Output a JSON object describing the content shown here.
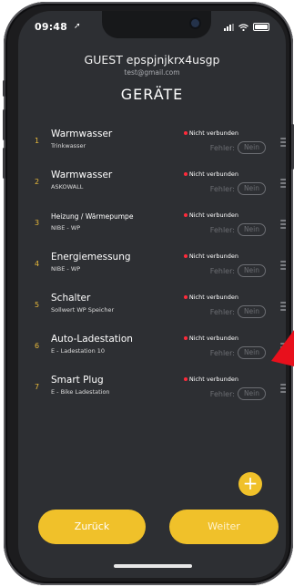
{
  "status_bar": {
    "time": "09:48"
  },
  "header": {
    "user_name": "GUEST epspjnjkrx4usgp",
    "email": "test@gmail.com",
    "title": "GERÄTE"
  },
  "devices": [
    {
      "index": "1",
      "name": "Warmwasser",
      "subtitle": "Trinkwasser",
      "status": "Nicht verbunden",
      "fehler_label": "Fehler:",
      "fehler_value": "Nein"
    },
    {
      "index": "2",
      "name": "Warmwasser",
      "subtitle": "ASKOWALL",
      "status": "Nicht verbunden",
      "fehler_label": "Fehler:",
      "fehler_value": "Nein"
    },
    {
      "index": "3",
      "name": "Heizung / Wärmepumpe",
      "subtitle": "NIBE - WP",
      "status": "Nicht verbunden",
      "fehler_label": "Fehler:",
      "fehler_value": "Nein"
    },
    {
      "index": "4",
      "name": "Energiemessung",
      "subtitle": "NIBE - WP",
      "status": "Nicht verbunden",
      "fehler_label": "Fehler:",
      "fehler_value": "Nein"
    },
    {
      "index": "5",
      "name": "Schalter",
      "subtitle": "Sollwert WP Speicher",
      "status": "Nicht verbunden",
      "fehler_label": "Fehler:",
      "fehler_value": "Nein"
    },
    {
      "index": "6",
      "name": "Auto-Ladestation",
      "subtitle": "E - Ladestation 10",
      "status": "Nicht verbunden",
      "fehler_label": "Fehler:",
      "fehler_value": "Nein"
    },
    {
      "index": "7",
      "name": "Smart Plug",
      "subtitle": "E - Bike Ladestation",
      "status": "Nicht verbunden",
      "fehler_label": "Fehler:",
      "fehler_value": "Nein"
    }
  ],
  "actions": {
    "add": "+",
    "back": "Zurück",
    "next": "Weiter"
  },
  "colors": {
    "accent": "#f0c12a",
    "background": "#2d2f33",
    "status_dot": "#ff2a3a",
    "annotation_arrow": "#e8101c"
  },
  "icons": [
    "location-arrow-icon",
    "signal-icon",
    "wifi-icon",
    "battery-icon",
    "drag-handle-icon",
    "plus-icon"
  ]
}
